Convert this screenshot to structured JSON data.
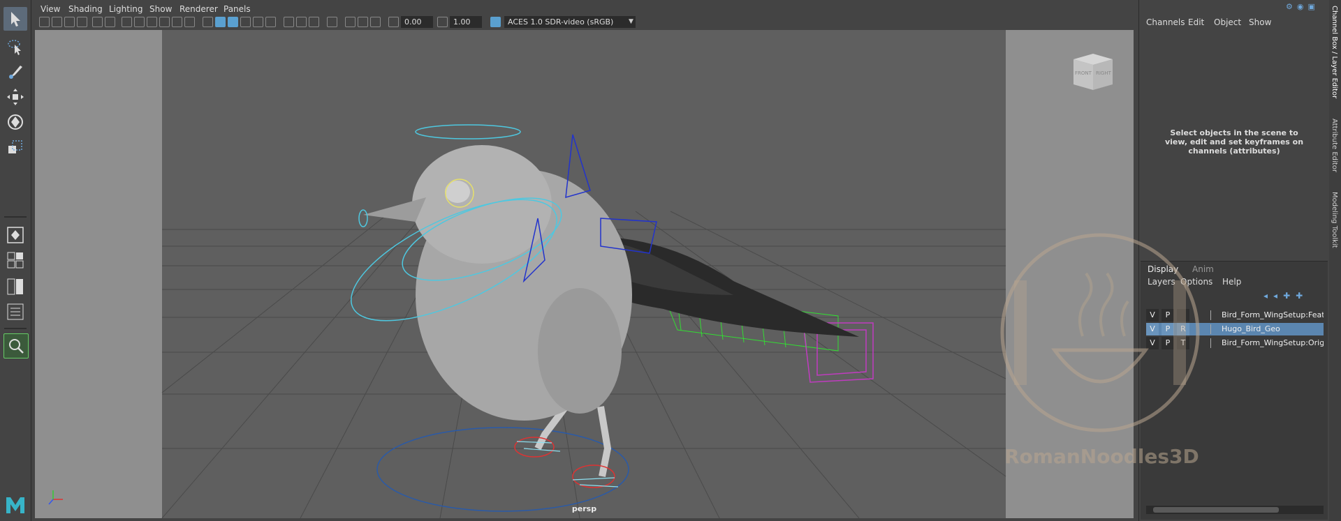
{
  "viewport_menu": [
    "View",
    "Shading",
    "Lighting",
    "Show",
    "Renderer",
    "Panels"
  ],
  "toolbar": {
    "exposure": "0.00",
    "gamma": "1.00",
    "color_space": "ACES 1.0 SDR-video (sRGB)"
  },
  "viewport": {
    "camera_label": "persp",
    "viewcube": {
      "front": "FRONT",
      "right": "RIGHT"
    }
  },
  "channel_box": {
    "menu": [
      "Channels",
      "Edit",
      "Object",
      "Show"
    ],
    "message": "Select objects in the scene to view, edit and set keyframes on channels (attributes)"
  },
  "layer_editor": {
    "tabs": [
      "Display",
      "Anim"
    ],
    "menu": [
      "Layers",
      "Options",
      "Help"
    ],
    "layers": [
      {
        "v": "V",
        "p": "P",
        "t": "",
        "name": "Bird_Form_WingSetup:FeathersLa",
        "selected": false
      },
      {
        "v": "V",
        "p": "P",
        "t": "R",
        "name": "Hugo_Bird_Geo",
        "selected": true
      },
      {
        "v": "V",
        "p": "P",
        "t": "T",
        "name": "Bird_Form_WingSetup:Original",
        "selected": false
      }
    ]
  },
  "side_tabs": [
    "Channel Box / Layer Editor",
    "Attribute Editor",
    "Modeling Toolkit"
  ],
  "watermark": "RomanNoodles3D",
  "colors": {
    "accent": "#5aa0d0",
    "selection": "#5b86b0",
    "viewport_bg": "#5f5f5f"
  }
}
